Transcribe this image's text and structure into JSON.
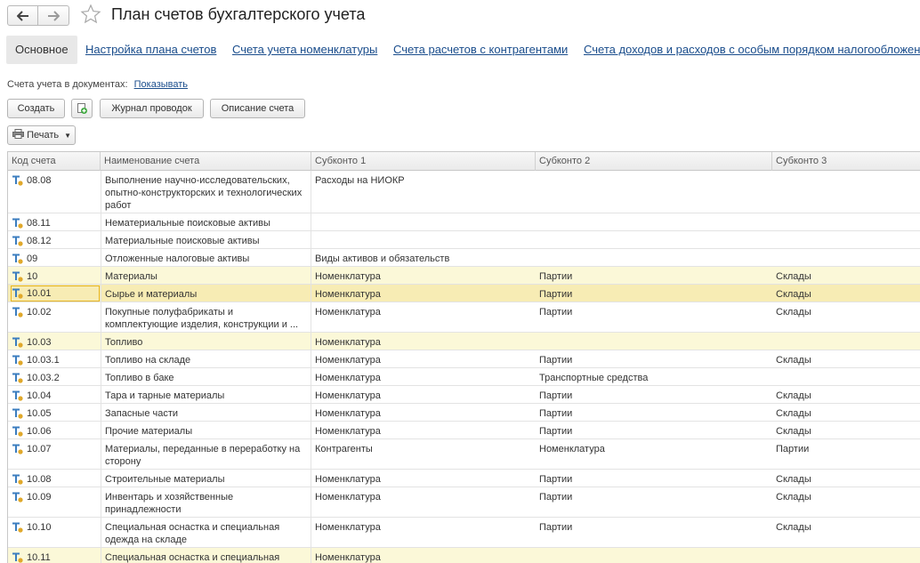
{
  "window": {
    "title": "План счетов бухгалтерского учета"
  },
  "tabs": [
    {
      "label": "Основное",
      "active": true
    },
    {
      "label": "Настройка плана счетов"
    },
    {
      "label": "Счета учета номенклатуры"
    },
    {
      "label": "Счета расчетов с контрагентами"
    },
    {
      "label": "Счета доходов и расходов с особым порядком налогообложения"
    }
  ],
  "info": {
    "label": "Счета учета в документах:",
    "link": "Показывать"
  },
  "toolbar": {
    "create_label": "Создать",
    "copy_icon": "add-copy-icon",
    "journal_label": "Журнал проводок",
    "description_label": "Описание счета",
    "print_label": "Печать"
  },
  "table": {
    "columns": [
      "Код счета",
      "Наименование счета",
      "Субконто 1",
      "Субконто 2",
      "Субконто 3"
    ],
    "rows": [
      {
        "code": "08.08",
        "name": "Выполнение научно-исследовательских, опытно-конструкторских и технологических работ",
        "s1": "Расходы на НИОКР",
        "s2": "",
        "s3": "",
        "style": "normal"
      },
      {
        "code": "08.11",
        "name": "Нематериальные поисковые активы",
        "s1": "",
        "s2": "",
        "s3": "",
        "style": "normal"
      },
      {
        "code": "08.12",
        "name": "Материальные поисковые активы",
        "s1": "",
        "s2": "",
        "s3": "",
        "style": "normal"
      },
      {
        "code": "09",
        "name": "Отложенные налоговые активы",
        "s1": "Виды активов и обязательств",
        "s2": "",
        "s3": "",
        "style": "normal"
      },
      {
        "code": "10",
        "name": "Материалы",
        "s1": "Номенклатура",
        "s2": "Партии",
        "s3": "Склады",
        "style": "yellow"
      },
      {
        "code": "10.01",
        "name": "Сырье и материалы",
        "s1": "Номенклатура",
        "s2": "Партии",
        "s3": "Склады",
        "style": "selected"
      },
      {
        "code": "10.02",
        "name": "Покупные полуфабрикаты и комплектующие изделия, конструкции и ...",
        "s1": "Номенклатура",
        "s2": "Партии",
        "s3": "Склады",
        "style": "normal"
      },
      {
        "code": "10.03",
        "name": "Топливо",
        "s1": "Номенклатура",
        "s2": "",
        "s3": "",
        "style": "yellow"
      },
      {
        "code": "10.03.1",
        "name": "Топливо на складе",
        "s1": "Номенклатура",
        "s2": "Партии",
        "s3": "Склады",
        "style": "normal"
      },
      {
        "code": "10.03.2",
        "name": "Топливо в баке",
        "s1": "Номенклатура",
        "s2": "Транспортные средства",
        "s3": "",
        "style": "normal"
      },
      {
        "code": "10.04",
        "name": "Тара и тарные материалы",
        "s1": "Номенклатура",
        "s2": "Партии",
        "s3": "Склады",
        "style": "normal"
      },
      {
        "code": "10.05",
        "name": "Запасные части",
        "s1": "Номенклатура",
        "s2": "Партии",
        "s3": "Склады",
        "style": "normal"
      },
      {
        "code": "10.06",
        "name": "Прочие материалы",
        "s1": "Номенклатура",
        "s2": "Партии",
        "s3": "Склады",
        "style": "normal"
      },
      {
        "code": "10.07",
        "name": "Материалы, переданные в переработку на сторону",
        "s1": "Контрагенты",
        "s2": "Номенклатура",
        "s3": "Партии",
        "style": "normal"
      },
      {
        "code": "10.08",
        "name": "Строительные материалы",
        "s1": "Номенклатура",
        "s2": "Партии",
        "s3": "Склады",
        "style": "normal"
      },
      {
        "code": "10.09",
        "name": "Инвентарь и хозяйственные принадлежности",
        "s1": "Номенклатура",
        "s2": "Партии",
        "s3": "Склады",
        "style": "normal"
      },
      {
        "code": "10.10",
        "name": "Специальная оснастка и специальная одежда на складе",
        "s1": "Номенклатура",
        "s2": "Партии",
        "s3": "Склады",
        "style": "normal"
      },
      {
        "code": "10.11",
        "name": "Специальная оснастка и специальная",
        "s1": "Номенклатура",
        "s2": "",
        "s3": "",
        "style": "yellow"
      }
    ]
  },
  "colors": {
    "link": "#1a4d8c",
    "row_yellow": "#fbf8d8",
    "row_selected": "#f7ecb4",
    "focus": "#e6b422"
  }
}
